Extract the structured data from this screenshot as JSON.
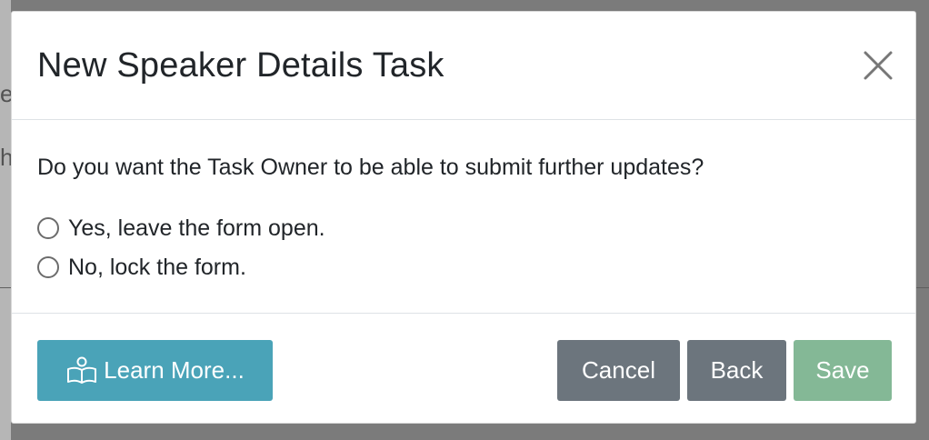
{
  "background": {
    "fragments": [
      "er",
      "h"
    ]
  },
  "dialog": {
    "title": "New Speaker Details Task",
    "question": "Do you want the Task Owner to be able to submit further updates?",
    "options": [
      {
        "label": "Yes, leave the form open.",
        "selected": false
      },
      {
        "label": "No, lock the form.",
        "selected": false
      }
    ],
    "buttons": {
      "learn_more": "Learn More...",
      "cancel": "Cancel",
      "back": "Back",
      "save": "Save"
    }
  },
  "colors": {
    "learn_more_bg": "#4aa3b8",
    "secondary_bg": "#6c757d",
    "save_bg": "#84b896"
  },
  "icons": {
    "close": "close-icon",
    "learn_more": "book-reader-icon"
  }
}
